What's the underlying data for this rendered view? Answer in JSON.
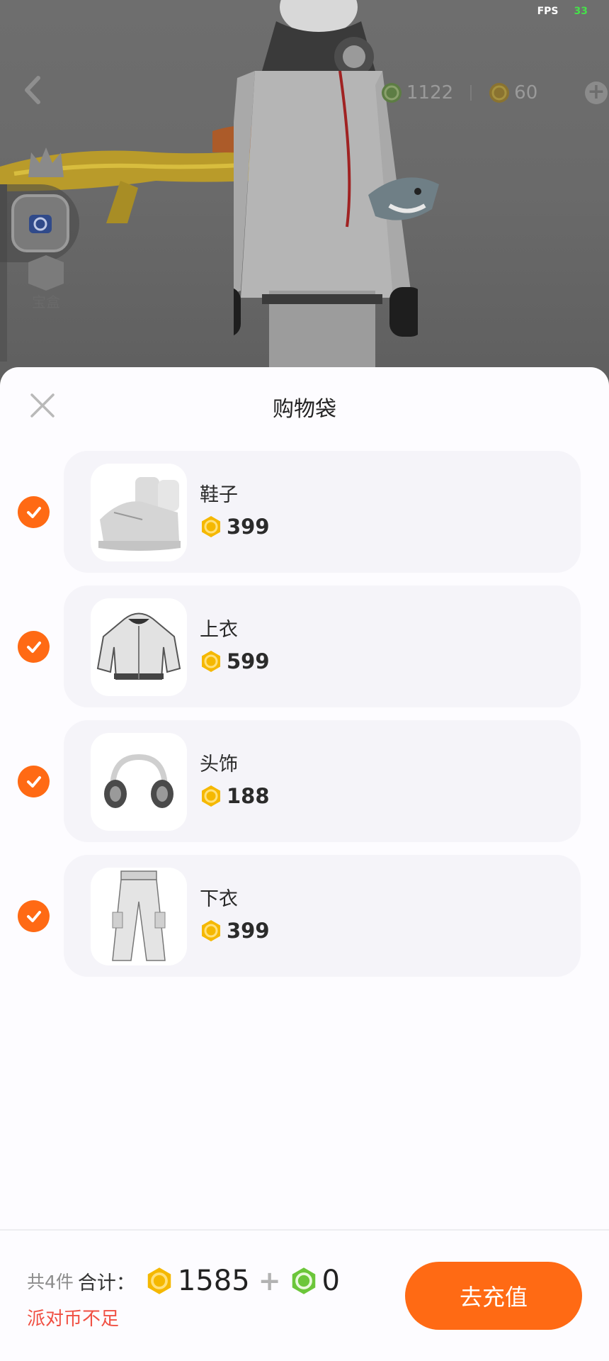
{
  "hud": {
    "fps_label": "FPS",
    "fps_value": "33",
    "green_coin_balance": "1122",
    "gold_coin_balance": "60",
    "side_box_label": "宝盒"
  },
  "sheet": {
    "title": "购物袋"
  },
  "items": [
    {
      "name": "鞋子",
      "price": "399",
      "checked": true,
      "thumb_icon": "sneakers-icon"
    },
    {
      "name": "上衣",
      "price": "599",
      "checked": true,
      "thumb_icon": "jacket-icon"
    },
    {
      "name": "头饰",
      "price": "188",
      "checked": true,
      "thumb_icon": "headphones-icon"
    },
    {
      "name": "下衣",
      "price": "399",
      "checked": true,
      "thumb_icon": "cargo-pants-icon"
    }
  ],
  "footer": {
    "count_text": "共4件",
    "total_label": "合计：",
    "gold_total": "1585",
    "plus": "+",
    "green_total": "0",
    "warning": "派对币不足",
    "recharge_button": "去充值"
  },
  "colors": {
    "accent": "#ff6a14",
    "warning": "#f05043",
    "gold_coin": "#f5b800",
    "green_coin": "#6cc63a"
  }
}
